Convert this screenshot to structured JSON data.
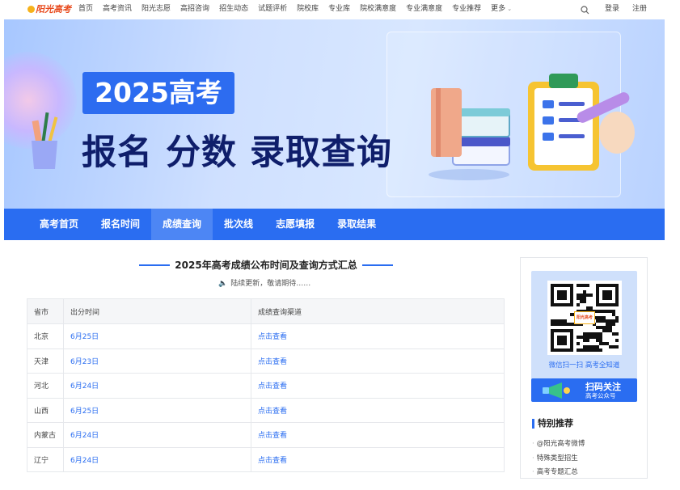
{
  "brand": {
    "logo_text": "阳光高考"
  },
  "nav": {
    "items": [
      "首页",
      "高考资讯",
      "阳光志愿",
      "高招咨询",
      "招生动态",
      "试题评析",
      "院校库",
      "专业库",
      "院校满意度",
      "专业满意度",
      "专业推荐"
    ],
    "more": "更多"
  },
  "auth": {
    "login": "登录",
    "register": "注册"
  },
  "banner": {
    "year_label": "2025高考",
    "headline": "报名 分数 录取查询"
  },
  "subnav": {
    "items": [
      "高考首页",
      "报名时间",
      "成绩查询",
      "批次线",
      "志愿填报",
      "录取结果"
    ],
    "active": "成绩查询"
  },
  "section": {
    "title": "2025年高考成绩公布时间及查询方式汇总",
    "note": "陆续更新，敬请期待……"
  },
  "table": {
    "headers": [
      "省市",
      "出分时间",
      "成绩查询渠道"
    ],
    "rows": [
      {
        "province": "北京",
        "date": "6月25日",
        "channel": "点击查看"
      },
      {
        "province": "天津",
        "date": "6月23日",
        "channel": "点击查看"
      },
      {
        "province": "河北",
        "date": "6月24日",
        "channel": "点击查看"
      },
      {
        "province": "山西",
        "date": "6月25日",
        "channel": "点击查看"
      },
      {
        "province": "内蒙古",
        "date": "6月24日",
        "channel": "点击查看"
      },
      {
        "province": "辽宁",
        "date": "6月24日",
        "channel": "点击查看"
      }
    ]
  },
  "sidebar": {
    "qr_caption": "微信扫一扫  高考全知道",
    "qr_banner_title": "扫码关注",
    "qr_banner_sub": "高考公众号",
    "qr_logo_text": "阳光高考",
    "recommend_title": "特别推荐",
    "recommend_items": [
      "@阳光高考微博",
      "特殊类型招生",
      "高考专题汇总"
    ]
  },
  "colors": {
    "primary": "#2a6df1",
    "banner_dark_text": "#0f1e6b"
  }
}
